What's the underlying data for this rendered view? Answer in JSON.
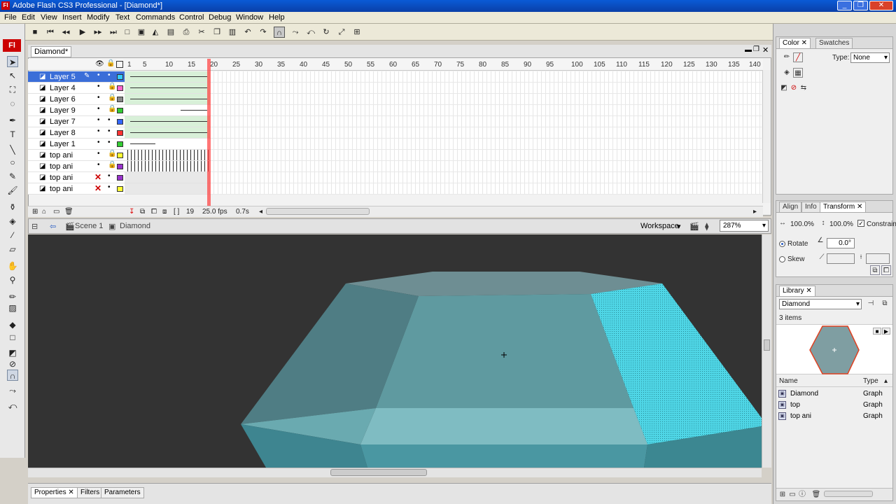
{
  "window": {
    "title": "Adobe Flash CS3 Professional - [Diamond*]",
    "app_icon": "Fl"
  },
  "menu": [
    "File",
    "Edit",
    "View",
    "Insert",
    "Modify",
    "Text",
    "Commands",
    "Control",
    "Debug",
    "Window",
    "Help"
  ],
  "tools_logo": "Fl",
  "timeline": {
    "tab": "Diamond*",
    "frame_numbers": [
      "1",
      "5",
      "10",
      "15",
      "20",
      "25",
      "30",
      "35",
      "40",
      "45",
      "50",
      "55",
      "60",
      "65",
      "70",
      "75",
      "80",
      "85",
      "90",
      "95",
      "100",
      "105",
      "110",
      "115",
      "120",
      "125",
      "130",
      "135",
      "140"
    ],
    "layers": [
      {
        "name": "Layer 5",
        "color": "#33ccff",
        "locked": false,
        "hidden": false,
        "selected": true
      },
      {
        "name": "Layer 4",
        "color": "#ff66cc",
        "locked": true,
        "hidden": false,
        "selected": false
      },
      {
        "name": "Layer 6",
        "color": "#888888",
        "locked": true,
        "hidden": false,
        "selected": false
      },
      {
        "name": "Layer 9",
        "color": "#33cc33",
        "locked": true,
        "hidden": false,
        "selected": false
      },
      {
        "name": "Layer 7",
        "color": "#3366ff",
        "locked": false,
        "hidden": false,
        "selected": false
      },
      {
        "name": "Layer 8",
        "color": "#ff3333",
        "locked": false,
        "hidden": false,
        "selected": false
      },
      {
        "name": "Layer 1",
        "color": "#33cc33",
        "locked": false,
        "hidden": false,
        "selected": false
      },
      {
        "name": "top ani",
        "color": "#ffff33",
        "locked": true,
        "hidden": false,
        "selected": false
      },
      {
        "name": "top ani",
        "color": "#9933cc",
        "locked": true,
        "hidden": false,
        "selected": false
      },
      {
        "name": "top ani",
        "color": "#9933cc",
        "locked": false,
        "hidden": true,
        "selected": false
      },
      {
        "name": "top ani",
        "color": "#ffff33",
        "locked": false,
        "hidden": true,
        "selected": false
      }
    ],
    "current_frame": "19",
    "fps": "25.0 fps",
    "time": "0.7s"
  },
  "editbar": {
    "scene": "Scene 1",
    "symbol": "Diamond",
    "workspace": "Workspace",
    "zoom": "287%"
  },
  "properties": {
    "tabs": [
      "Properties",
      "Filters",
      "Parameters"
    ]
  },
  "color_panel": {
    "tabs": [
      "Color",
      "Swatches"
    ],
    "type_label": "Type:",
    "type_value": "None"
  },
  "transform_panel": {
    "tabs": [
      "Align",
      "Info",
      "Transform"
    ],
    "width_pct": "100.0%",
    "height_pct": "100.0%",
    "constrain": "Constrain",
    "rotate_label": "Rotate",
    "rotate_value": "0.0°",
    "skew_label": "Skew"
  },
  "library": {
    "tab": "Library",
    "dropdown": "Diamond",
    "count": "3 items",
    "col_name": "Name",
    "col_type": "Type",
    "items": [
      {
        "name": "Diamond",
        "type": "Graph"
      },
      {
        "name": "top",
        "type": "Graph"
      },
      {
        "name": "top ani",
        "type": "Graph"
      }
    ]
  },
  "colors": {
    "stage_bg": "#333333",
    "facet_main": "#5f9aa0",
    "facet_highlight": "#4fd6e6",
    "selection_blue": "#3b6ed8",
    "playhead": "#ff4444"
  }
}
